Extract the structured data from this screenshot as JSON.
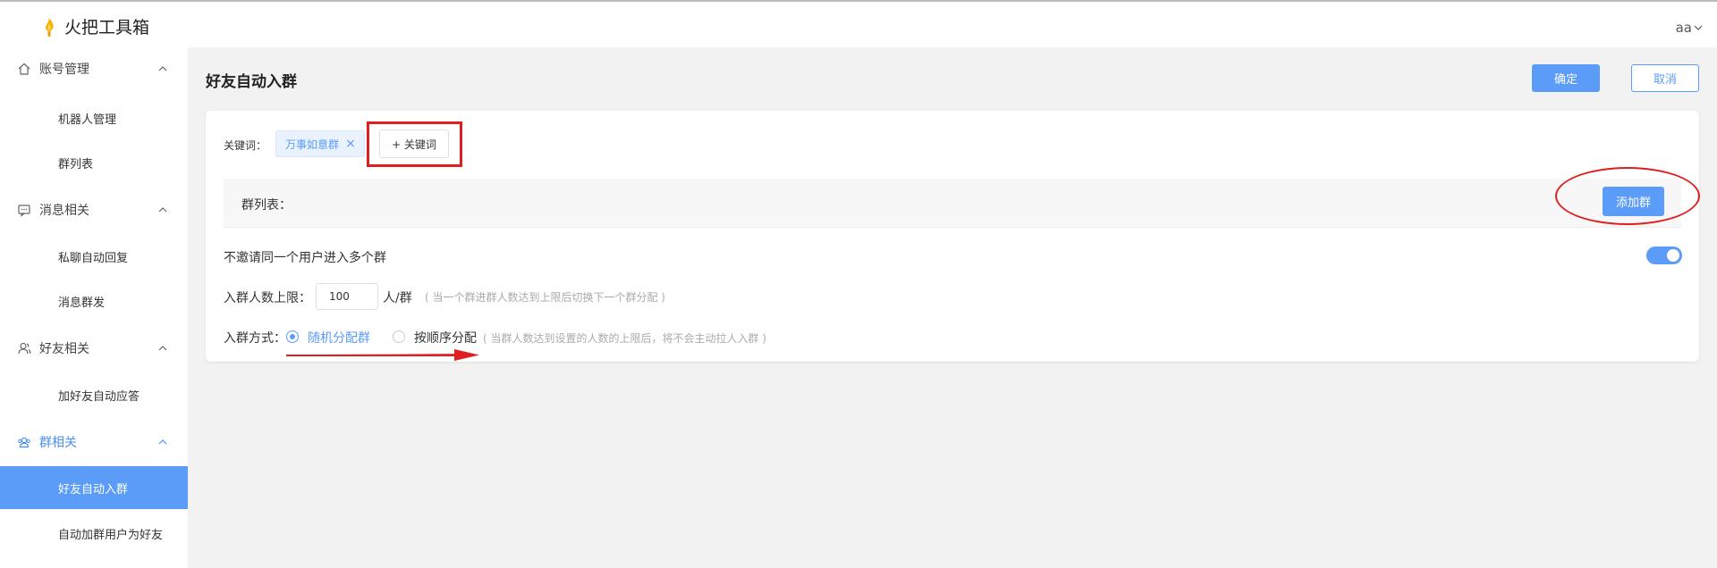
{
  "app": {
    "title": "火把工具箱",
    "user": "aa"
  },
  "sidebar": {
    "groups": [
      {
        "label": "账号管理",
        "icon": "home-icon",
        "items": [
          "机器人管理",
          "群列表"
        ]
      },
      {
        "label": "消息相关",
        "icon": "message-icon",
        "items": [
          "私聊自动回复",
          "消息群发"
        ]
      },
      {
        "label": "好友相关",
        "icon": "user-icon",
        "items": [
          "加好友自动应答"
        ]
      },
      {
        "label": "群相关",
        "icon": "group-icon",
        "items": [
          "好友自动入群",
          "自动加群用户为好友"
        ]
      }
    ],
    "active_item": "好友自动入群"
  },
  "page": {
    "title": "好友自动入群",
    "confirm": "确定",
    "cancel": "取消",
    "keyword_label": "关键词：",
    "keyword_tag": "万事如意群",
    "add_keyword": "+ 关键词",
    "group_list_label": "群列表：",
    "add_group": "添加群",
    "no_multi_label": "不邀请同一个用户进入多个群",
    "no_multi_enabled": true,
    "limit_label": "入群人数上限：",
    "limit_value": "100",
    "limit_unit": "人/群",
    "limit_hint": "( 当一个群进群人数达到上限后切换下一个群分配 )",
    "mode_label": "入群方式：",
    "mode_random": "随机分配群",
    "mode_sequential": "按顺序分配",
    "mode_hint": "( 当群人数达到设置的人数的上限后，将不会主动拉人入群 )",
    "selected_mode": "随机分配群"
  },
  "colors": {
    "accent": "#5b9cf8",
    "annotation": "#e02020"
  }
}
